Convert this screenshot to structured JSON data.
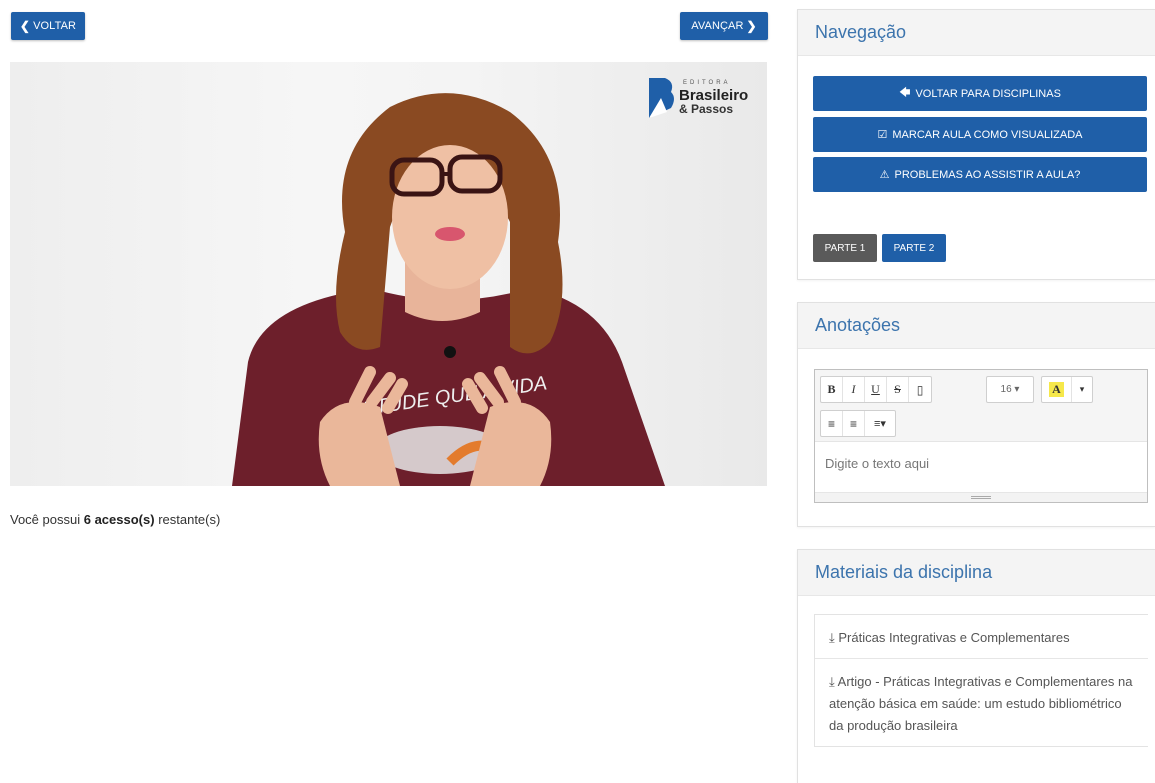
{
  "top_nav": {
    "back_label": "VOLTAR",
    "next_label": "AVANÇAR"
  },
  "video": {
    "logo_small": "EDITORA",
    "logo_line1": "Brasileiro",
    "logo_line2": "& Passos",
    "shirt_text": "ESTUDE QUE A VIDA MUDA"
  },
  "access": {
    "prefix": "Você possui",
    "count": "6 acesso(s)",
    "suffix": "restante(s)"
  },
  "navigation": {
    "title": "Navegação",
    "buttons": [
      {
        "icon": "arrow-left-icon",
        "label": "VOLTAR PARA DISCIPLINAS"
      },
      {
        "icon": "check-square-icon",
        "label": "MARCAR AULA COMO VISUALIZADA"
      },
      {
        "icon": "warning-icon",
        "label": "PROBLEMAS AO ASSISTIR A AULA?"
      }
    ],
    "parts": [
      "PARTE 1",
      "PARTE 2"
    ],
    "active_part": "PARTE 1"
  },
  "notes": {
    "title": "Anotações",
    "font_size": "16",
    "placeholder": "Digite o texto aqui"
  },
  "materials": {
    "title": "Materiais da disciplina",
    "items": [
      "Práticas Integrativas e Complementares",
      "Artigo - Práticas Integrativas e Complementares na atenção básica em saúde: um estudo bibliométrico da produção brasileira"
    ]
  },
  "colors": {
    "primary": "#1f5fa8",
    "heading": "#3c74ad",
    "active_part": "#5a5a5a"
  }
}
